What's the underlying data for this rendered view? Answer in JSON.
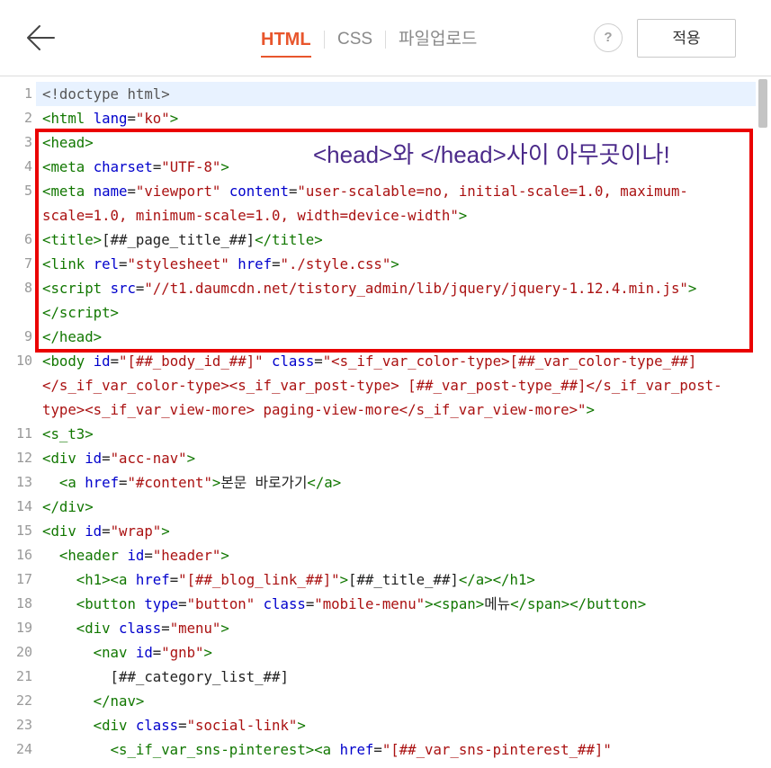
{
  "topbar": {
    "back_icon": "arrow-left-icon",
    "tabs": [
      {
        "label": "HTML",
        "active": true
      },
      {
        "label": "CSS",
        "active": false
      },
      {
        "label": "파일업로드",
        "active": false
      }
    ],
    "help_label": "?",
    "apply_label": "적용"
  },
  "colors": {
    "accent": "#e8562d",
    "tag": "#117700",
    "attr": "#0000cc",
    "str": "#aa1111",
    "meta": "#555555",
    "txt": "#222222",
    "active_line": "#e8f2ff",
    "annotation_border": "#ea0000",
    "annotation_text": "#4b2a8a"
  },
  "editor": {
    "active_line": 1,
    "lines": [
      {
        "num": "1",
        "rows": [
          [
            [
              "meta",
              "<!doctype html>"
            ]
          ]
        ]
      },
      {
        "num": "2",
        "rows": [
          [
            [
              "tag",
              "<html"
            ],
            [
              "txt",
              " "
            ],
            [
              "attr",
              "lang"
            ],
            [
              "txt",
              "="
            ],
            [
              "str",
              "\"ko\""
            ],
            [
              "tag",
              ">"
            ]
          ]
        ]
      },
      {
        "num": "3",
        "rows": [
          [
            [
              "tag",
              "<head>"
            ]
          ]
        ]
      },
      {
        "num": "4",
        "rows": [
          [
            [
              "tag",
              "<meta"
            ],
            [
              "txt",
              " "
            ],
            [
              "attr",
              "charset"
            ],
            [
              "txt",
              "="
            ],
            [
              "str",
              "\"UTF-8\""
            ],
            [
              "tag",
              ">"
            ]
          ]
        ]
      },
      {
        "num": "5",
        "rows": [
          [
            [
              "tag",
              "<meta"
            ],
            [
              "txt",
              " "
            ],
            [
              "attr",
              "name"
            ],
            [
              "txt",
              "="
            ],
            [
              "str",
              "\"viewport\""
            ],
            [
              "txt",
              " "
            ],
            [
              "attr",
              "content"
            ],
            [
              "txt",
              "="
            ],
            [
              "str",
              "\"user-scalable=no, initial-scale=1.0, maximum-"
            ]
          ],
          [
            [
              "str",
              "scale=1.0, minimum-scale=1.0, width=device-width\""
            ],
            [
              "tag",
              ">"
            ]
          ]
        ]
      },
      {
        "num": "6",
        "rows": [
          [
            [
              "tag",
              "<title>"
            ],
            [
              "txt",
              "[##_page_title_##]"
            ],
            [
              "tag",
              "</title>"
            ]
          ]
        ]
      },
      {
        "num": "7",
        "rows": [
          [
            [
              "tag",
              "<link"
            ],
            [
              "txt",
              " "
            ],
            [
              "attr",
              "rel"
            ],
            [
              "txt",
              "="
            ],
            [
              "str",
              "\"stylesheet\""
            ],
            [
              "txt",
              " "
            ],
            [
              "attr",
              "href"
            ],
            [
              "txt",
              "="
            ],
            [
              "str",
              "\"./style.css\""
            ],
            [
              "tag",
              ">"
            ]
          ]
        ]
      },
      {
        "num": "8",
        "rows": [
          [
            [
              "tag",
              "<script"
            ],
            [
              "txt",
              " "
            ],
            [
              "attr",
              "src"
            ],
            [
              "txt",
              "="
            ],
            [
              "str",
              "\"//t1.daumcdn.net/tistory_admin/lib/jquery/jquery-1.12.4.min.js\""
            ],
            [
              "tag",
              ">"
            ]
          ],
          [
            [
              "tag",
              "</script>"
            ]
          ]
        ]
      },
      {
        "num": "9",
        "rows": [
          [
            [
              "tag",
              "</head>"
            ]
          ]
        ]
      },
      {
        "num": "10",
        "rows": [
          [
            [
              "tag",
              "<body"
            ],
            [
              "txt",
              " "
            ],
            [
              "attr",
              "id"
            ],
            [
              "txt",
              "="
            ],
            [
              "str",
              "\"[##_body_id_##]\""
            ],
            [
              "txt",
              " "
            ],
            [
              "attr",
              "class"
            ],
            [
              "txt",
              "="
            ],
            [
              "str",
              "\"<s_if_var_color-type>[##_var_color-type_##]"
            ]
          ],
          [
            [
              "str",
              "</s_if_var_color-type><s_if_var_post-type> [##_var_post-type_##]</s_if_var_post-"
            ]
          ],
          [
            [
              "str",
              "type><s_if_var_view-more> paging-view-more</s_if_var_view-more>\""
            ],
            [
              "tag",
              ">"
            ]
          ]
        ]
      },
      {
        "num": "11",
        "rows": [
          [
            [
              "tag",
              "<s_t3>"
            ]
          ]
        ]
      },
      {
        "num": "12",
        "rows": [
          [
            [
              "tag",
              "<div"
            ],
            [
              "txt",
              " "
            ],
            [
              "attr",
              "id"
            ],
            [
              "txt",
              "="
            ],
            [
              "str",
              "\"acc-nav\""
            ],
            [
              "tag",
              ">"
            ]
          ]
        ]
      },
      {
        "num": "13",
        "rows": [
          [
            [
              "txt",
              "  "
            ],
            [
              "tag",
              "<a"
            ],
            [
              "txt",
              " "
            ],
            [
              "attr",
              "href"
            ],
            [
              "txt",
              "="
            ],
            [
              "str",
              "\"#content\""
            ],
            [
              "tag",
              ">"
            ],
            [
              "txt",
              "본문 바로가기"
            ],
            [
              "tag",
              "</a>"
            ]
          ]
        ]
      },
      {
        "num": "14",
        "rows": [
          [
            [
              "tag",
              "</div>"
            ]
          ]
        ]
      },
      {
        "num": "15",
        "rows": [
          [
            [
              "tag",
              "<div"
            ],
            [
              "txt",
              " "
            ],
            [
              "attr",
              "id"
            ],
            [
              "txt",
              "="
            ],
            [
              "str",
              "\"wrap\""
            ],
            [
              "tag",
              ">"
            ]
          ]
        ]
      },
      {
        "num": "16",
        "rows": [
          [
            [
              "txt",
              "  "
            ],
            [
              "tag",
              "<header"
            ],
            [
              "txt",
              " "
            ],
            [
              "attr",
              "id"
            ],
            [
              "txt",
              "="
            ],
            [
              "str",
              "\"header\""
            ],
            [
              "tag",
              ">"
            ]
          ]
        ]
      },
      {
        "num": "17",
        "rows": [
          [
            [
              "txt",
              "    "
            ],
            [
              "tag",
              "<h1><a"
            ],
            [
              "txt",
              " "
            ],
            [
              "attr",
              "href"
            ],
            [
              "txt",
              "="
            ],
            [
              "str",
              "\"[##_blog_link_##]\""
            ],
            [
              "tag",
              ">"
            ],
            [
              "txt",
              "[##_title_##]"
            ],
            [
              "tag",
              "</a></h1>"
            ]
          ]
        ]
      },
      {
        "num": "18",
        "rows": [
          [
            [
              "txt",
              "    "
            ],
            [
              "tag",
              "<button"
            ],
            [
              "txt",
              " "
            ],
            [
              "attr",
              "type"
            ],
            [
              "txt",
              "="
            ],
            [
              "str",
              "\"button\""
            ],
            [
              "txt",
              " "
            ],
            [
              "attr",
              "class"
            ],
            [
              "txt",
              "="
            ],
            [
              "str",
              "\"mobile-menu\""
            ],
            [
              "tag",
              "><span>"
            ],
            [
              "txt",
              "메뉴"
            ],
            [
              "tag",
              "</span></button>"
            ]
          ]
        ]
      },
      {
        "num": "19",
        "rows": [
          [
            [
              "txt",
              "    "
            ],
            [
              "tag",
              "<div"
            ],
            [
              "txt",
              " "
            ],
            [
              "attr",
              "class"
            ],
            [
              "txt",
              "="
            ],
            [
              "str",
              "\"menu\""
            ],
            [
              "tag",
              ">"
            ]
          ]
        ]
      },
      {
        "num": "20",
        "rows": [
          [
            [
              "txt",
              "      "
            ],
            [
              "tag",
              "<nav"
            ],
            [
              "txt",
              " "
            ],
            [
              "attr",
              "id"
            ],
            [
              "txt",
              "="
            ],
            [
              "str",
              "\"gnb\""
            ],
            [
              "tag",
              ">"
            ]
          ]
        ]
      },
      {
        "num": "21",
        "rows": [
          [
            [
              "txt",
              "        [##_category_list_##]"
            ]
          ]
        ]
      },
      {
        "num": "22",
        "rows": [
          [
            [
              "txt",
              "      "
            ],
            [
              "tag",
              "</nav>"
            ]
          ]
        ]
      },
      {
        "num": "23",
        "rows": [
          [
            [
              "txt",
              "      "
            ],
            [
              "tag",
              "<div"
            ],
            [
              "txt",
              " "
            ],
            [
              "attr",
              "class"
            ],
            [
              "txt",
              "="
            ],
            [
              "str",
              "\"social-link\""
            ],
            [
              "tag",
              ">"
            ]
          ]
        ]
      },
      {
        "num": "24",
        "rows": [
          [
            [
              "txt",
              "        "
            ],
            [
              "tag",
              "<s_if_var_sns-pinterest><a"
            ],
            [
              "txt",
              " "
            ],
            [
              "attr",
              "href"
            ],
            [
              "txt",
              "="
            ],
            [
              "str",
              "\"[##_var_sns-pinterest_##]\""
            ]
          ]
        ]
      }
    ]
  },
  "annotation": {
    "text": "<head>와 </head>사이 아무곳이나!"
  }
}
